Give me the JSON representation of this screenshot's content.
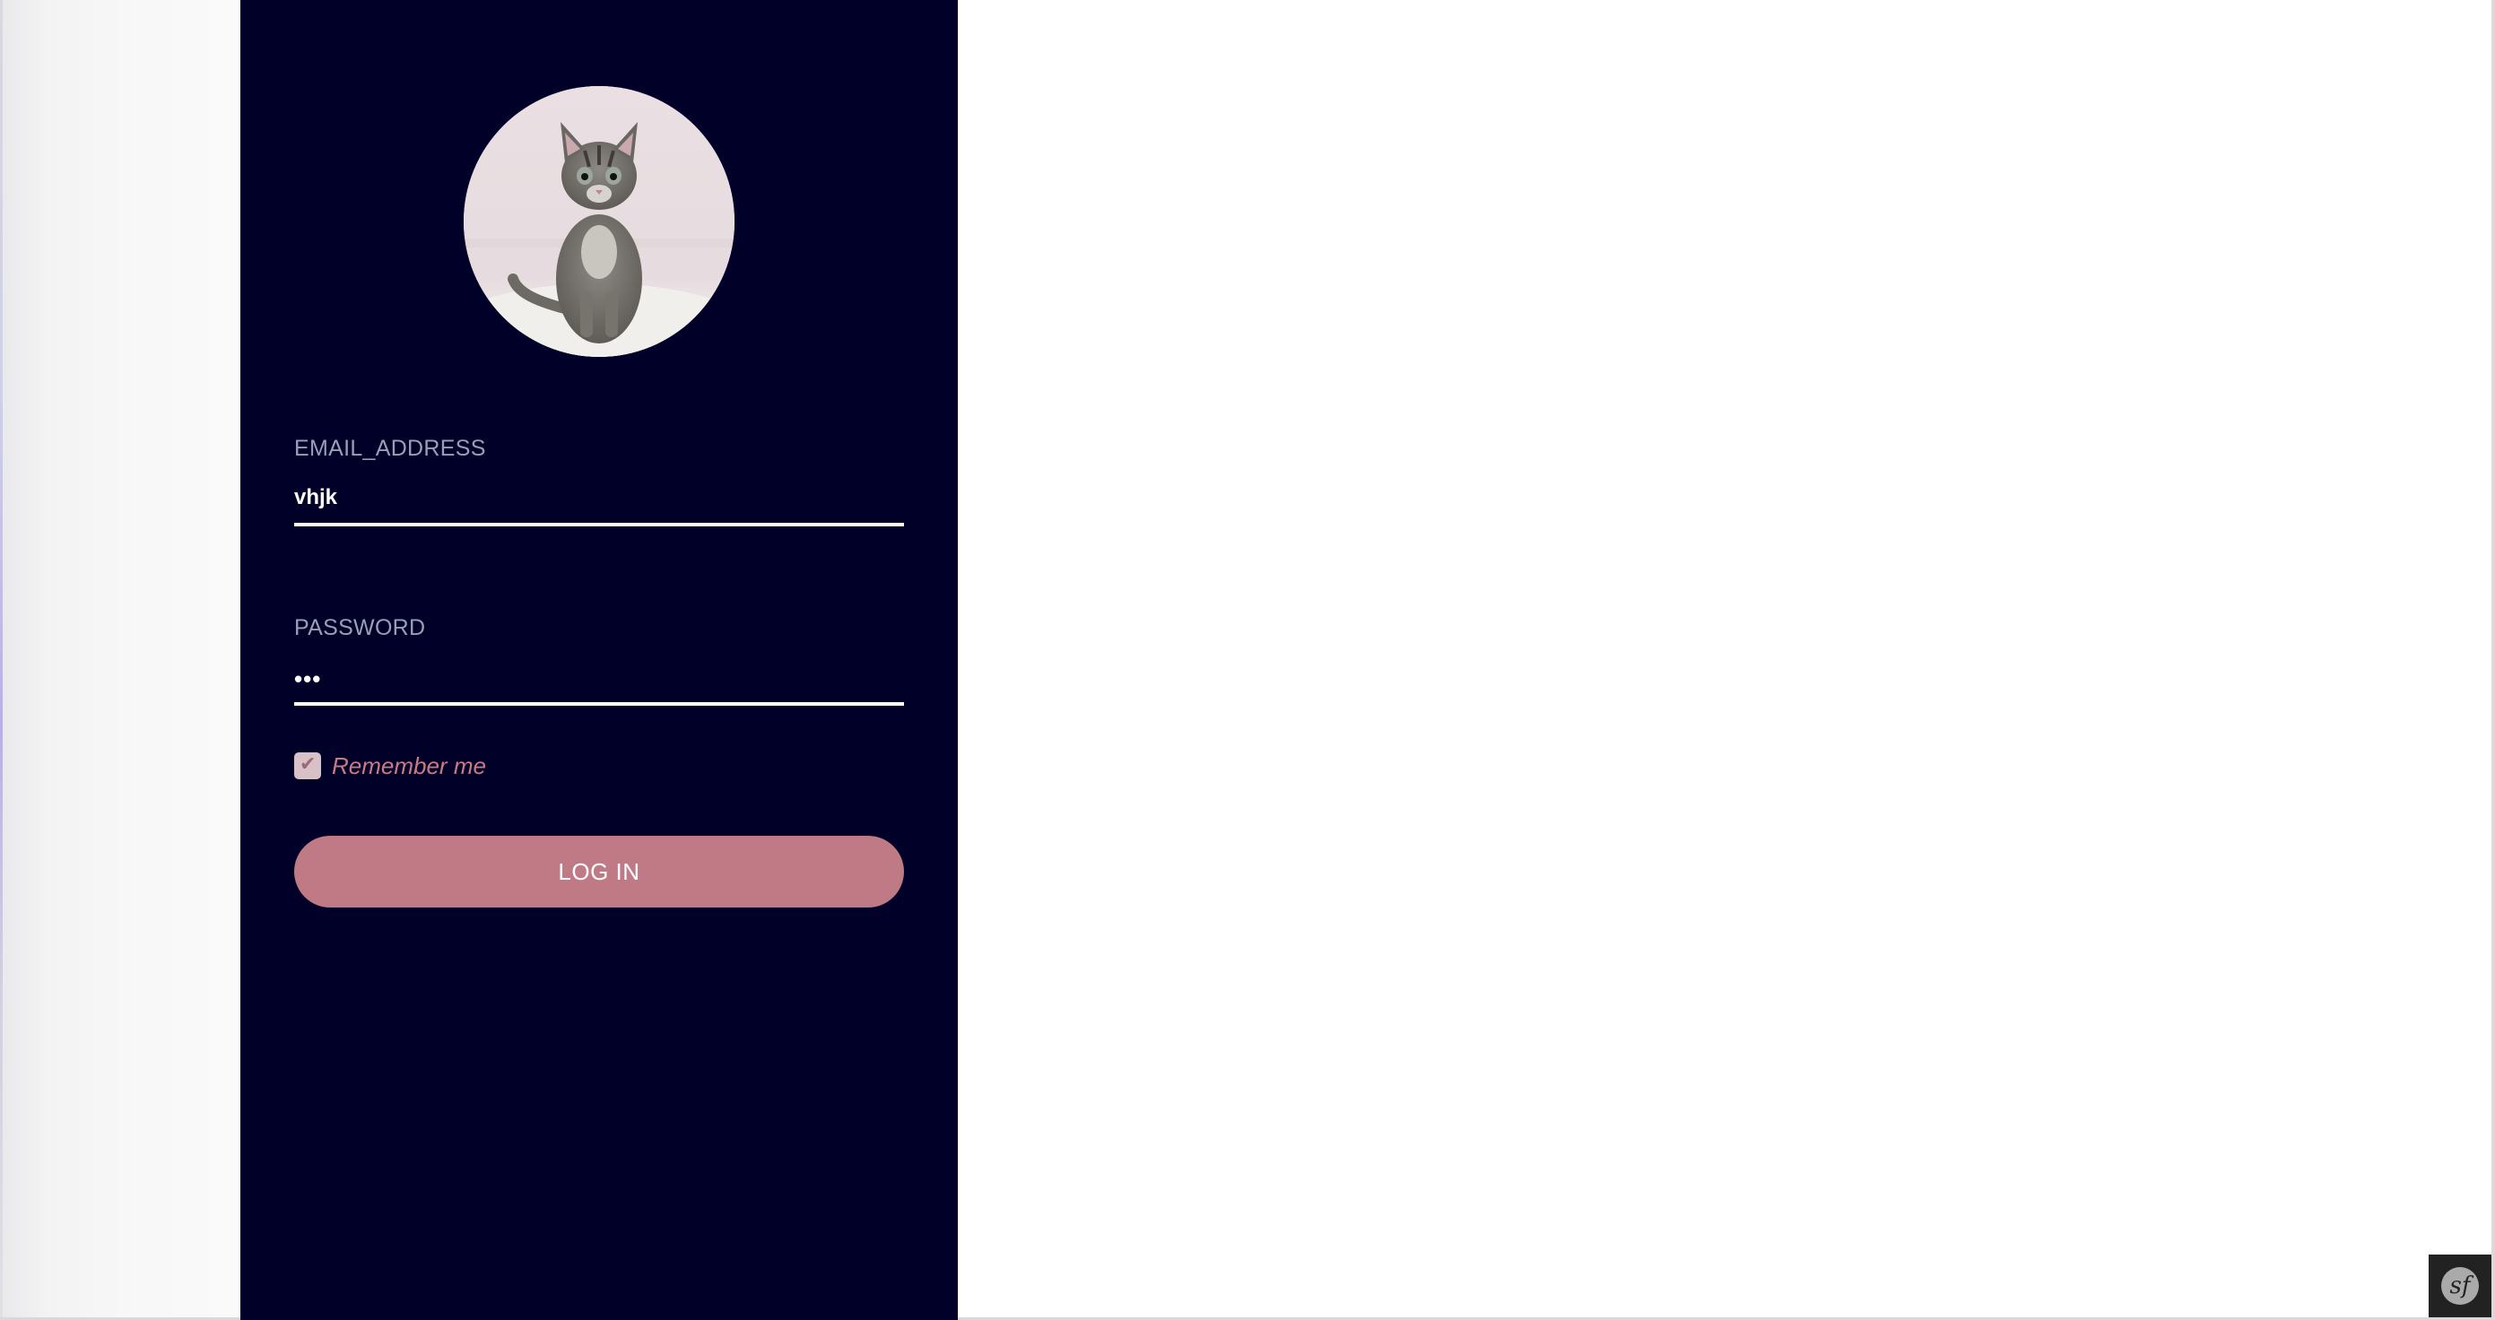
{
  "login_form": {
    "email": {
      "label": "EMAIL_ADDRESS",
      "value": "vhjk"
    },
    "password": {
      "label": "PASSWORD",
      "value": "•••"
    },
    "remember_me": {
      "label": "Remember me",
      "checked": true
    },
    "submit_label": "LOG IN"
  },
  "avatar": {
    "icon": "kitten-photo"
  },
  "debug_toolbar": {
    "icon": "symfony-logo-icon",
    "glyph": "sf"
  },
  "colors": {
    "panel_background": "#000028",
    "button_background": "#c07a86",
    "remember_label": "#c77b87",
    "field_label": "#9a9fb8",
    "input_underline": "#ffffff"
  }
}
